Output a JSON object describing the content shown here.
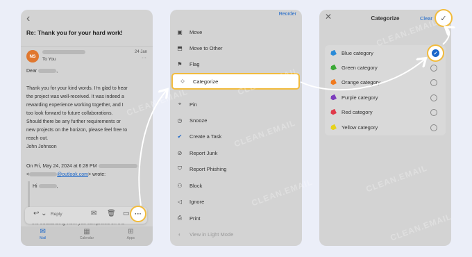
{
  "email": {
    "subject": "Re: Thank you for your hard work!",
    "avatar_initials": "NS",
    "to": "To You",
    "date": "24 Jan",
    "more_small": "···",
    "greeting": "Dear",
    "body_lines": [
      "Thank you for your kind words. I'm glad to hear",
      "the project was well-received. It was indeed a",
      "rewarding experience working together, and I",
      "too look forward to future collaborations.",
      "Should there be any further requirements or",
      "new projects on the horizon, please feel free to",
      "reach out.",
      "John Johnson"
    ],
    "quote_header_1": "On Fri, May 24, 2024 at 6:28 PM",
    "quote_header_2_prefix": "<",
    "quote_header_2_link": "@outlook.com",
    "quote_header_2_suffix": "> wrote:",
    "quote_hi": "Hi",
    "quote_tail": "the outstanding work you completed on the",
    "reply_label": "Reply",
    "more_button": "···",
    "tabs": [
      {
        "label": "Mail",
        "icon": "mail-icon"
      },
      {
        "label": "Calendar",
        "icon": "calendar-icon"
      },
      {
        "label": "Apps",
        "icon": "apps-icon"
      }
    ]
  },
  "menu": {
    "reorder": "Reorder",
    "items": [
      {
        "label": "Move",
        "icon": "folder-move-icon"
      },
      {
        "label": "Move to Other",
        "icon": "move-other-icon"
      },
      {
        "label": "Flag",
        "icon": "flag-icon"
      },
      {
        "label": "Categorize",
        "icon": "tag-icon"
      },
      {
        "label": "Pin",
        "icon": "pin-icon"
      },
      {
        "label": "Snooze",
        "icon": "clock-icon"
      },
      {
        "label": "Create a Task",
        "icon": "checkmark-icon"
      },
      {
        "label": "Report Junk",
        "icon": "block-circle-icon"
      },
      {
        "label": "Report Phishing",
        "icon": "shield-icon"
      },
      {
        "label": "Block",
        "icon": "block-person-icon"
      },
      {
        "label": "Ignore",
        "icon": "mute-icon"
      },
      {
        "label": "Print",
        "icon": "printer-icon"
      },
      {
        "label": "View in Light Mode",
        "icon": "contrast-icon"
      }
    ]
  },
  "categorize": {
    "title": "Categorize",
    "clear": "Clear",
    "categories": [
      {
        "label": "Blue category",
        "color": "#2a8bd8",
        "selected": true
      },
      {
        "label": "Green category",
        "color": "#3aa935",
        "selected": false
      },
      {
        "label": "Orange category",
        "color": "#f07a1e",
        "selected": false
      },
      {
        "label": "Purple category",
        "color": "#7c3dbd",
        "selected": false
      },
      {
        "label": "Red category",
        "color": "#e03a4a",
        "selected": false
      },
      {
        "label": "Yellow category",
        "color": "#e6d21c",
        "selected": false
      }
    ]
  },
  "watermark": "CLEAN.EMAIL",
  "colors": {
    "highlight": "#f2bb3c",
    "accent": "#1a66c9"
  }
}
